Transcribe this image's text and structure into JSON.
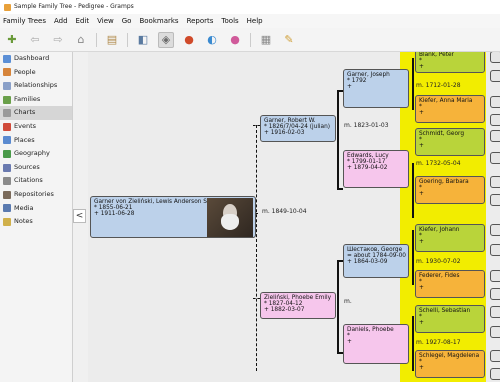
{
  "window": {
    "title": "Sample Family Tree - Pedigree - Gramps"
  },
  "menu": [
    "Family Trees",
    "Add",
    "Edit",
    "View",
    "Go",
    "Bookmarks",
    "Reports",
    "Tools",
    "Help"
  ],
  "sidebar": {
    "items": [
      {
        "label": "Dashboard",
        "icon": "dashboard-icon",
        "color": "#5b8fd6"
      },
      {
        "label": "People",
        "icon": "people-icon",
        "color": "#d6843a"
      },
      {
        "label": "Relationships",
        "icon": "relationships-icon",
        "color": "#8aa0c8"
      },
      {
        "label": "Families",
        "icon": "families-icon",
        "color": "#6aa04a"
      },
      {
        "label": "Charts",
        "icon": "charts-icon",
        "color": "#999999",
        "selected": true
      },
      {
        "label": "Events",
        "icon": "events-icon",
        "color": "#d04a3a"
      },
      {
        "label": "Places",
        "icon": "places-icon",
        "color": "#5a8ad0"
      },
      {
        "label": "Geography",
        "icon": "geography-icon",
        "color": "#4a9a4a"
      },
      {
        "label": "Sources",
        "icon": "sources-icon",
        "color": "#6a7ab0"
      },
      {
        "label": "Citations",
        "icon": "citations-icon",
        "color": "#8a8a8a"
      },
      {
        "label": "Repositories",
        "icon": "repositories-icon",
        "color": "#7a6a5a"
      },
      {
        "label": "Media",
        "icon": "media-icon",
        "color": "#5a7ab0"
      },
      {
        "label": "Notes",
        "icon": "notes-icon",
        "color": "#d0b04a"
      }
    ],
    "collapse": "<"
  },
  "pedigree": {
    "root": {
      "name": "Garner von Zieliński, Lewis Anderson Sr",
      "birth": "* 1855-06-21",
      "death": "+ 1911-06-28"
    },
    "root_marriage": "m. 1849-10-04",
    "father": {
      "name": "Garner, Robert W.",
      "birth": "* 1826/7/04-24 (julian)",
      "death": "+ 1916-02-03"
    },
    "mother": {
      "name": "Zieliński, Phoebe Emily",
      "birth": "* 1827-04-12",
      "death": "+ 1882-03-07"
    },
    "ff": {
      "name": "Garner, Joseph",
      "birth": "* 1792",
      "death": "+"
    },
    "ff_marriage": "m. 1823-01-03",
    "fm": {
      "name": "Edwards, Lucy",
      "birth": "* 1799-01-17",
      "death": "+ 1879-04-02"
    },
    "mf": {
      "name": "Шестаков, George",
      "birth": "= about 1784-09-00",
      "death": "+ 1864-03-09"
    },
    "mf_marriage": "m.",
    "mm": {
      "name": "Daniels, Phoebe",
      "birth": "*",
      "death": "+"
    },
    "g1": {
      "name": "Blank, Peter",
      "birth": "*",
      "death": "+"
    },
    "g1_marriage": "m. 1712-01-28",
    "g2": {
      "name": "Kiefer, Anna Maria",
      "birth": "*",
      "death": "+"
    },
    "g3": {
      "name": "Schmidt, Georg",
      "birth": "*",
      "death": "+"
    },
    "g3_marriage": "m. 1732-05-04",
    "g4": {
      "name": "Goering, Barbara",
      "birth": "*",
      "death": "+"
    },
    "g5": {
      "name": "Kiefer, Johann",
      "birth": "*",
      "death": "+"
    },
    "g5_marriage": "m. 1930-07-02",
    "g6": {
      "name": "Federer, Fides",
      "birth": "*",
      "death": "+"
    },
    "g7": {
      "name": "Schelli, Sebastian",
      "birth": "*",
      "death": "+"
    },
    "g7_marriage": "m. 1927-08-17",
    "g8": {
      "name": "Schlegel, Magdelena",
      "birth": "*",
      "death": "+"
    }
  },
  "colors": {
    "male": "#bcd1ea",
    "female": "#f6c6ec",
    "highlight": "#f2ed00",
    "gen_male": "#b9d43a",
    "gen_female": "#f6b33a"
  }
}
